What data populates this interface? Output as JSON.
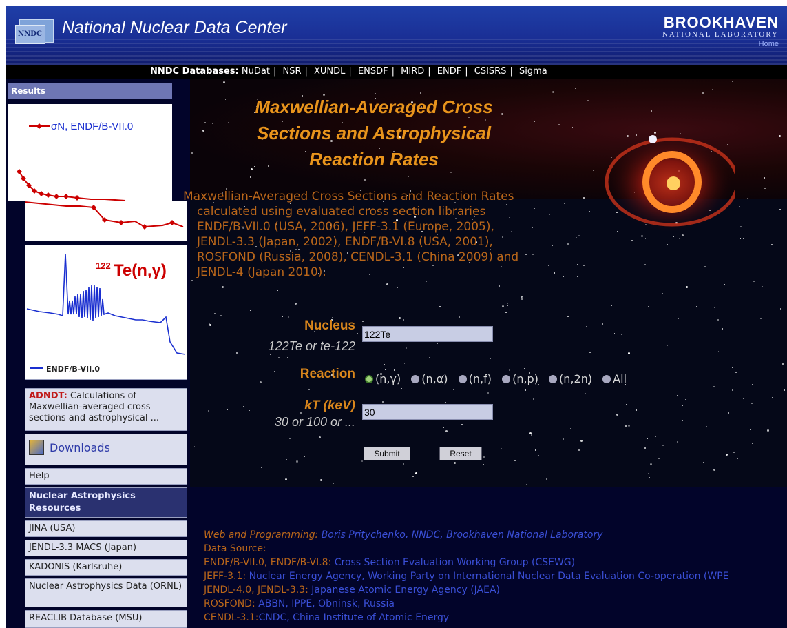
{
  "header": {
    "logo_text": "NNDC",
    "site_title": "National Nuclear Data Center",
    "bnl_line1": "BROOKHAVEN",
    "bnl_line2": "NATIONAL LABORATORY",
    "home_link": "Home"
  },
  "dbnav": {
    "label": "NNDC Databases:",
    "items": [
      "NuDat",
      "NSR",
      "XUNDL",
      "ENSDF",
      "MIRD",
      "ENDF",
      "CSISRS",
      "Sigma"
    ]
  },
  "sidebar": {
    "results_label": "Results",
    "graph1_legend": "σN, ENDF/B-VII.0",
    "graph2_title_sup": "122",
    "graph2_title": "Te(n,γ)",
    "graph2_legend": "ENDF/B-VII.0",
    "adndt_bold": "ADNDT:",
    "adndt_text": " Calculations of Maxwellian-averaged cross sections and astrophysical ...",
    "downloads": "Downloads",
    "help": "Help",
    "resources_title": "Nuclear Astrophysics Resources",
    "links": [
      "JINA (USA)",
      "JENDL-3.3 MACS (Japan)",
      "KADONIS (Karlsruhe)",
      "Nuclear Astrophysics Data (ORNL)",
      "REACLIB Database (MSU)"
    ]
  },
  "main": {
    "title_line1": "Maxwellian-Averaged Cross",
    "title_line2": "Sections and Astrophysical",
    "title_line3": "Reaction Rates",
    "intro_lines": [
      "Maxwellian-Averaged Cross Sections and Reaction Rates",
      "calculated using evaluated cross section libraries",
      "ENDF/B-VII.0 (USA, 2006), JEFF-3.1 (Europe, 2005),",
      "JENDL-3.3 (Japan, 2002), ENDF/B-VI.8 (USA, 2001),",
      "ROSFOND (Russia, 2008), CENDL-3.1 (China 2009) and",
      "JENDL-4 (Japan 2010)."
    ]
  },
  "form": {
    "nucleus_label": "Nucleus",
    "nucleus_hint": "122Te or te-122",
    "nucleus_value": "122Te",
    "reaction_label": "Reaction",
    "reactions": [
      "(n,γ)",
      "(n,α)",
      "(n,f)",
      "(n,p)",
      "(n,2n)",
      "All"
    ],
    "selected_reaction": "(n,γ)",
    "kt_label": "kT (keV)",
    "kt_hint": "30 or 100 or ...",
    "kt_value": "30",
    "submit": "Submit",
    "reset": "Reset"
  },
  "credits": {
    "web_label": "Web and Programming:",
    "web_value": "Boris Pritychenko, NNDC, Brookhaven National Laboratory",
    "data_source": "Data Source:",
    "rows": [
      {
        "lib": "ENDF/B-VII.0, ENDF/B-VI.8:",
        "org": "Cross Section Evaluation Working Group (CSEWG)"
      },
      {
        "lib": "JEFF-3.1:",
        "org": "Nuclear Energy Agency, Working Party on International Nuclear Data Evaluation Co-operation (WPE"
      },
      {
        "lib": "JENDL-4.0, JENDL-3.3:",
        "org": "Japanese Atomic Energy Agency (JAEA)"
      },
      {
        "lib": "ROSFOND:",
        "org": "ABBN, IPPE, Obninsk, Russia"
      },
      {
        "lib": "CENDL-3.1:",
        "org": "CNDC, China Institute of Atomic Energy"
      }
    ]
  },
  "colors": {
    "header_blue": "#1a2f95",
    "title_orange": "#e8941c",
    "link_blue": "#3a4fd6",
    "sidebar_bg": "#02042a"
  }
}
